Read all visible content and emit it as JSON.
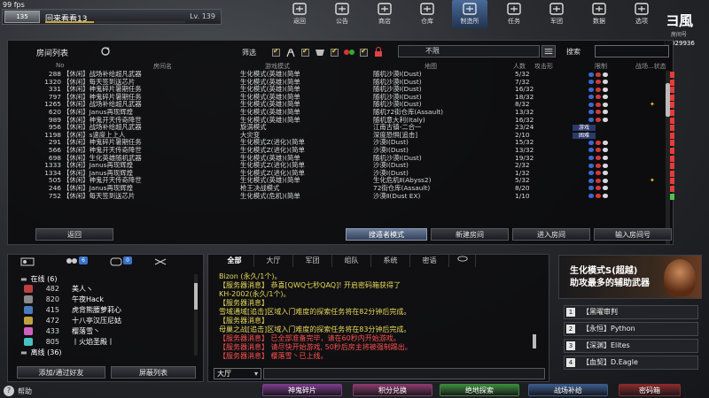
{
  "fps": "99 fps",
  "player": {
    "avatar_label": "135",
    "name": "回来看看13",
    "level": "Lv. 139",
    "exp_fraction": 0.35
  },
  "nav": [
    {
      "label": "返回",
      "icon": "return-icon"
    },
    {
      "label": "公告",
      "icon": "megaphone-icon"
    },
    {
      "label": "商店",
      "icon": "shop-icon"
    },
    {
      "label": "仓库",
      "icon": "warehouse-icon"
    },
    {
      "label": "制造所",
      "icon": "factory-icon",
      "active": true
    },
    {
      "label": "任务",
      "icon": "mission-icon"
    },
    {
      "label": "军团",
      "icon": "clan-icon"
    },
    {
      "label": "数据",
      "icon": "data-icon"
    },
    {
      "label": "选项",
      "icon": "gear-icon"
    }
  ],
  "logo": {
    "mark": "ヨ風",
    "sub": "房间号",
    "uid": "10029936"
  },
  "room_list": {
    "title": "房间列表",
    "filter_label": "筛选",
    "full_filter": "不限",
    "search_label": "搜索",
    "search_value": "",
    "headers": {
      "no": "No",
      "name": "房间名",
      "mode": "游戏模式",
      "map": "地图",
      "count": "人数",
      "status": "攻击形",
      "flags": "限制",
      "clan": "战场...状态"
    },
    "rows": [
      {
        "no": "288",
        "name": "【休闲】战场补给超凡武器",
        "mode": "生化模式(英雄)(简单",
        "map": "随机沙漠Ⅰ(Dust)",
        "count": "5/32",
        "star": false,
        "play": "red"
      },
      {
        "no": "1320",
        "name": "【休闲】每天签到送芯片",
        "mode": "生化模式(英雄)(简单",
        "map": "随机沙漠Ⅰ(Dust)",
        "count": "7/32",
        "star": false,
        "play": "red"
      },
      {
        "no": "331",
        "name": "【休闲】神鬼碎片暑期任务",
        "mode": "生化模式(英雄)(简单",
        "map": "随机沙漠Ⅰ(Dust)",
        "count": "16/32",
        "star": false,
        "play": "red"
      },
      {
        "no": "797",
        "name": "【休闲】神鬼碎片暑期任务",
        "mode": "生化模式(英雄)(简单",
        "map": "随机沙漠Ⅰ(Dust)",
        "count": "18/32",
        "star": false,
        "play": "red"
      },
      {
        "no": "1265",
        "name": "【休闲】战场补给超凡武器",
        "mode": "生化模式(英雄)(简单",
        "map": "随机沙漠Ⅰ(Dust)",
        "count": "8/32",
        "star": true,
        "play": "red"
      },
      {
        "no": "620",
        "name": "【休闲】Janus再现辉煌",
        "mode": "生化模式(英雄)(简单",
        "map": "随机72街仓库(Assault)",
        "count": "13/32",
        "star": false,
        "play": "red"
      },
      {
        "no": "989",
        "name": "【休闲】神鬼开天传奇降世",
        "mode": "生化模式(英雄)(简单",
        "map": "随机意大利(Italy)",
        "count": "16/32",
        "star": false,
        "play": "red"
      },
      {
        "no": "956",
        "name": "【休闲】战场补给超凡武器",
        "mode": "旋涡模式",
        "map": "江南古镇-二合一",
        "count": "23/24",
        "tag": "游戏",
        "star": false,
        "play": "red"
      },
      {
        "no": "1198",
        "name": "【休闲】s速度上上人",
        "mode": "大灾变",
        "map": "深度恐惧[追击]",
        "count": "2/10",
        "tag": "困难",
        "star": false,
        "play": "red"
      },
      {
        "no": "291",
        "name": "【休闲】神鬼碎片暑期任务",
        "mode": "生化模式Z(进化)(简单",
        "map": "沙漠Ⅰ(Dust)",
        "count": "15/32",
        "star": false,
        "play": "red"
      },
      {
        "no": "566",
        "name": "【休闲】神鬼开天传奇降世",
        "mode": "生化模式Z(进化)(简单",
        "map": "沙漠Ⅰ(Dust)",
        "count": "13/32",
        "star": false,
        "play": "red"
      },
      {
        "no": "698",
        "name": "【休闲】生化英雄随机武器",
        "mode": "生化模式(英雄)(简单",
        "map": "随机沙漠Ⅰ(Dust)",
        "count": "19/32",
        "star": false,
        "play": "red"
      },
      {
        "no": "1333",
        "name": "【休闲】Janus再现辉煌",
        "mode": "生化模式Z(进化)(简单",
        "map": "沙漠Ⅰ(Dust)",
        "count": "2/32",
        "star": false,
        "play": "red"
      },
      {
        "no": "1334",
        "name": "【休闲】Janus再现辉煌",
        "mode": "生化模式Z(进化)(简单",
        "map": "沙漠Ⅰ(Dust)",
        "count": "1/32",
        "star": false,
        "play": "red"
      },
      {
        "no": "505",
        "name": "【休闲】神鬼开天传奇降世",
        "mode": "生化模式(英雄)(简单",
        "map": "生化危机Ⅱ(Abyss2)",
        "count": "5/32",
        "star": true,
        "play": "red"
      },
      {
        "no": "246",
        "name": "【休闲】Janus再现辉煌",
        "mode": "枪王决战模式",
        "map": "72街仓库(Assault)",
        "count": "8/20",
        "star": false,
        "play": "red"
      },
      {
        "no": "752",
        "name": "【休闲】每天签到送芯片",
        "mode": "生化模式(危机)(简单",
        "map": "沙漠Ⅱ(Dust EX)",
        "count": "1/10",
        "star": false,
        "play": "green"
      }
    ]
  },
  "room_buttons": {
    "back": "返回",
    "lurker": "搜遁者模式",
    "create": "新建房间",
    "enter": "进入房间",
    "enter_no": "输入房间号"
  },
  "friends": {
    "tab_badges": [
      "",
      "6",
      "0",
      ""
    ],
    "online_label": "在线 (6)",
    "offline_label": "离线 (36)",
    "list": [
      {
        "level": "482",
        "name": "美人ヽ",
        "color": "#c04040"
      },
      {
        "level": "820",
        "name": "午夜Hack",
        "color": "#8a8a8a"
      },
      {
        "level": "415",
        "name": "虎背熊腰萝莉心",
        "color": "#4a7ac0"
      },
      {
        "level": "472",
        "name": "十八亭汉压尼姑",
        "color": "#c0a040"
      },
      {
        "level": "433",
        "name": "樱落雪丶",
        "color": "#d060c0"
      },
      {
        "level": "805",
        "name": "丨火焰圣殿丨",
        "color": "#4ac0c0"
      }
    ],
    "add_button": "添加/通过好友",
    "block_button": "屏蔽列表"
  },
  "chat": {
    "tabs": [
      "全部",
      "大厅",
      "军团",
      "组队",
      "系统",
      "密语"
    ],
    "lines": [
      {
        "text": "Bizon (永久/1个)。",
        "cls": "y"
      },
      {
        "text": "【服务器消息】 恭喜[QWQ七秒QAQ]! 开启密码箱获得了",
        "cls": "y"
      },
      {
        "text": "KH-2002(永久/1个)。",
        "cls": "y"
      },
      {
        "text": "【服务器消息】",
        "cls": "y"
      },
      {
        "text": "雪域通域[追击]区域入门难度的探索任务将在82分钟后完成。",
        "cls": "y"
      },
      {
        "text": "【服务器消息】",
        "cls": "y"
      },
      {
        "text": "母巢之战[追击]区域入门难度的探索任务将在83分钟后完成。",
        "cls": "y"
      },
      {
        "text": "【服务器消息】 已全部准备完毕，请在60秒内开始游戏。",
        "cls": "r"
      },
      {
        "text": "【服务器消息】 请尽快开始游戏, 50秒后房主将被强制踢出。",
        "cls": "r"
      },
      {
        "text": "【服务器消息】 樱落雪丶已上线。",
        "cls": "r"
      }
    ],
    "channel": "大厅",
    "input_value": ""
  },
  "promo": {
    "line1": "生化模式S(超越)",
    "line2": "助攻最多的辅助武器"
  },
  "clans": [
    {
      "idx": "1",
      "name": "【黑曜审判"
    },
    {
      "idx": "2",
      "name": "【永恒】Python"
    },
    {
      "idx": "3",
      "name": "【深渊】Elites"
    },
    {
      "idx": "4",
      "name": "【血契】D.Eagle"
    }
  ],
  "bottom": {
    "help": "帮助",
    "buttons": [
      {
        "label": "神鬼碎片",
        "color": "#7a3a8a"
      },
      {
        "label": "积分兑换",
        "color": "#8a3a6a"
      },
      {
        "label": "绝地探索",
        "color": "#3a8a3a"
      },
      {
        "label": "战场补给",
        "color": "#3a5a8a"
      },
      {
        "label": "密码箱",
        "color": "#8a2a2a"
      }
    ]
  },
  "colors": {
    "accent": "#e8c93a",
    "highlight_tab": "#4a6a9a"
  }
}
